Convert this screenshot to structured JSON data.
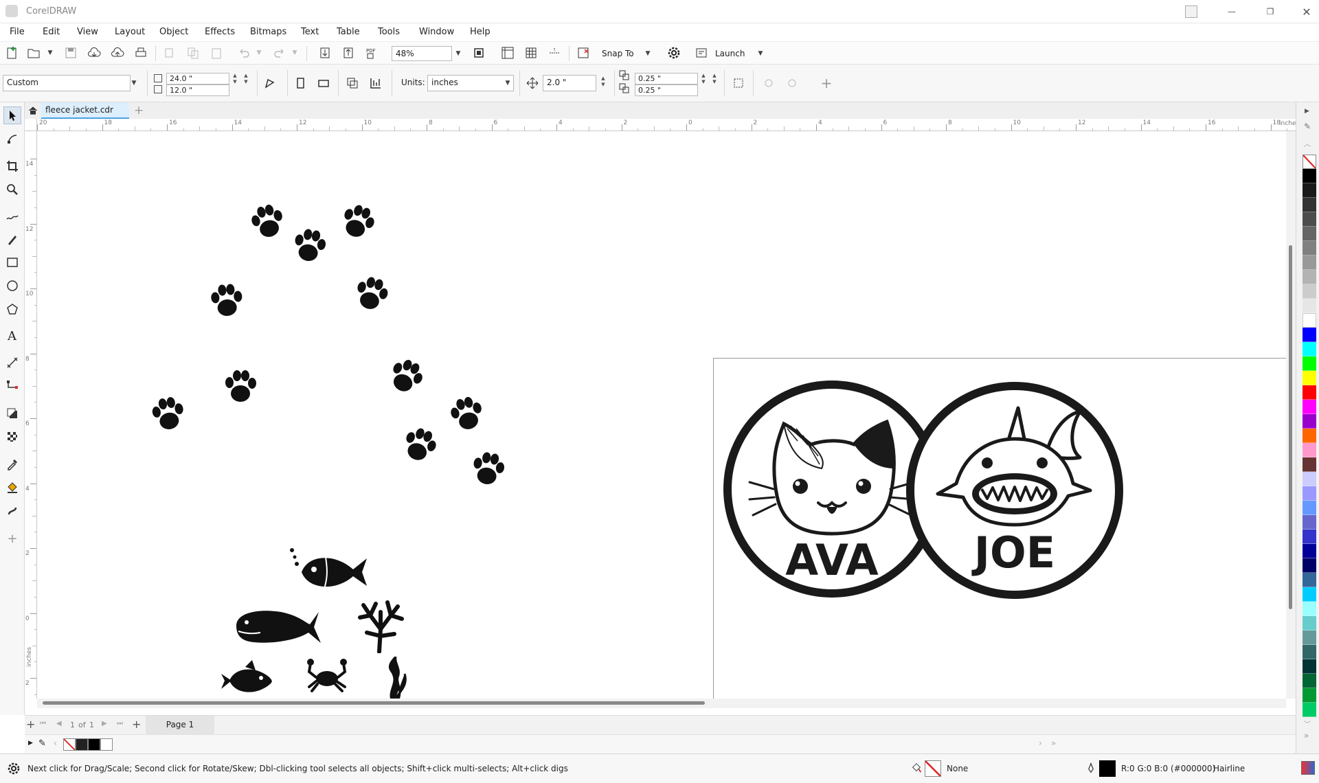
{
  "app": {
    "title": "CorelDRAW"
  },
  "menu": [
    "File",
    "Edit",
    "View",
    "Layout",
    "Object",
    "Effects",
    "Bitmaps",
    "Text",
    "Table",
    "Tools",
    "Window",
    "Help"
  ],
  "toolbar": {
    "zoom": "48%",
    "snap_label": "Snap To",
    "launch_label": "Launch"
  },
  "propertybar": {
    "page_size": "Custom",
    "width": "24.0 \"",
    "height": "12.0 \"",
    "units_label": "Units:",
    "units_value": "inches",
    "nudge": "2.0 \"",
    "dup_x": "0.25 \"",
    "dup_y": "0.25 \""
  },
  "document": {
    "tab": "fleece jacket.cdr"
  },
  "ruler": {
    "h_labels": [
      "20",
      "18",
      "16",
      "14",
      "12",
      "10",
      "8",
      "6",
      "4",
      "2",
      "0",
      "2",
      "4",
      "6",
      "8",
      "10",
      "12",
      "14",
      "16",
      "18"
    ],
    "h_units": "inches",
    "v_labels": [
      "14",
      "12",
      "10",
      "8",
      "6",
      "4",
      "2",
      "0",
      "2"
    ],
    "v_units": "inches"
  },
  "artwork": {
    "name1": "AVA",
    "name2": "JOE"
  },
  "pagenav": {
    "current": "1",
    "of_label": "of",
    "total": "1",
    "page_tab": "Page 1"
  },
  "status": {
    "hint": "Next click for Drag/Scale; Second click for Rotate/Skew; Dbl-clicking tool selects all objects; Shift+click multi-selects; Alt+click digs",
    "fill": "None",
    "outline_color": "R:0 G:0 B:0 (#000000)",
    "outline_width": "Hairline"
  },
  "palette_colors": [
    "#000000",
    "#1a1a1a",
    "#333333",
    "#4d4d4d",
    "#666666",
    "#808080",
    "#999999",
    "#b3b3b3",
    "#cccccc",
    "#e6e6e6",
    "#ffffff",
    "#0000ff",
    "#00ffff",
    "#00ff00",
    "#ffff00",
    "#ff0000",
    "#ff00ff",
    "#9900cc",
    "#ff6600",
    "#ff99cc",
    "#663333",
    "#ccccff",
    "#9999ff",
    "#6699ff",
    "#6666cc",
    "#3333cc",
    "#000099",
    "#000066",
    "#336699",
    "#00ccff",
    "#99ffff",
    "#66cccc",
    "#669999",
    "#336666",
    "#003333",
    "#006633",
    "#009933",
    "#00cc66"
  ]
}
